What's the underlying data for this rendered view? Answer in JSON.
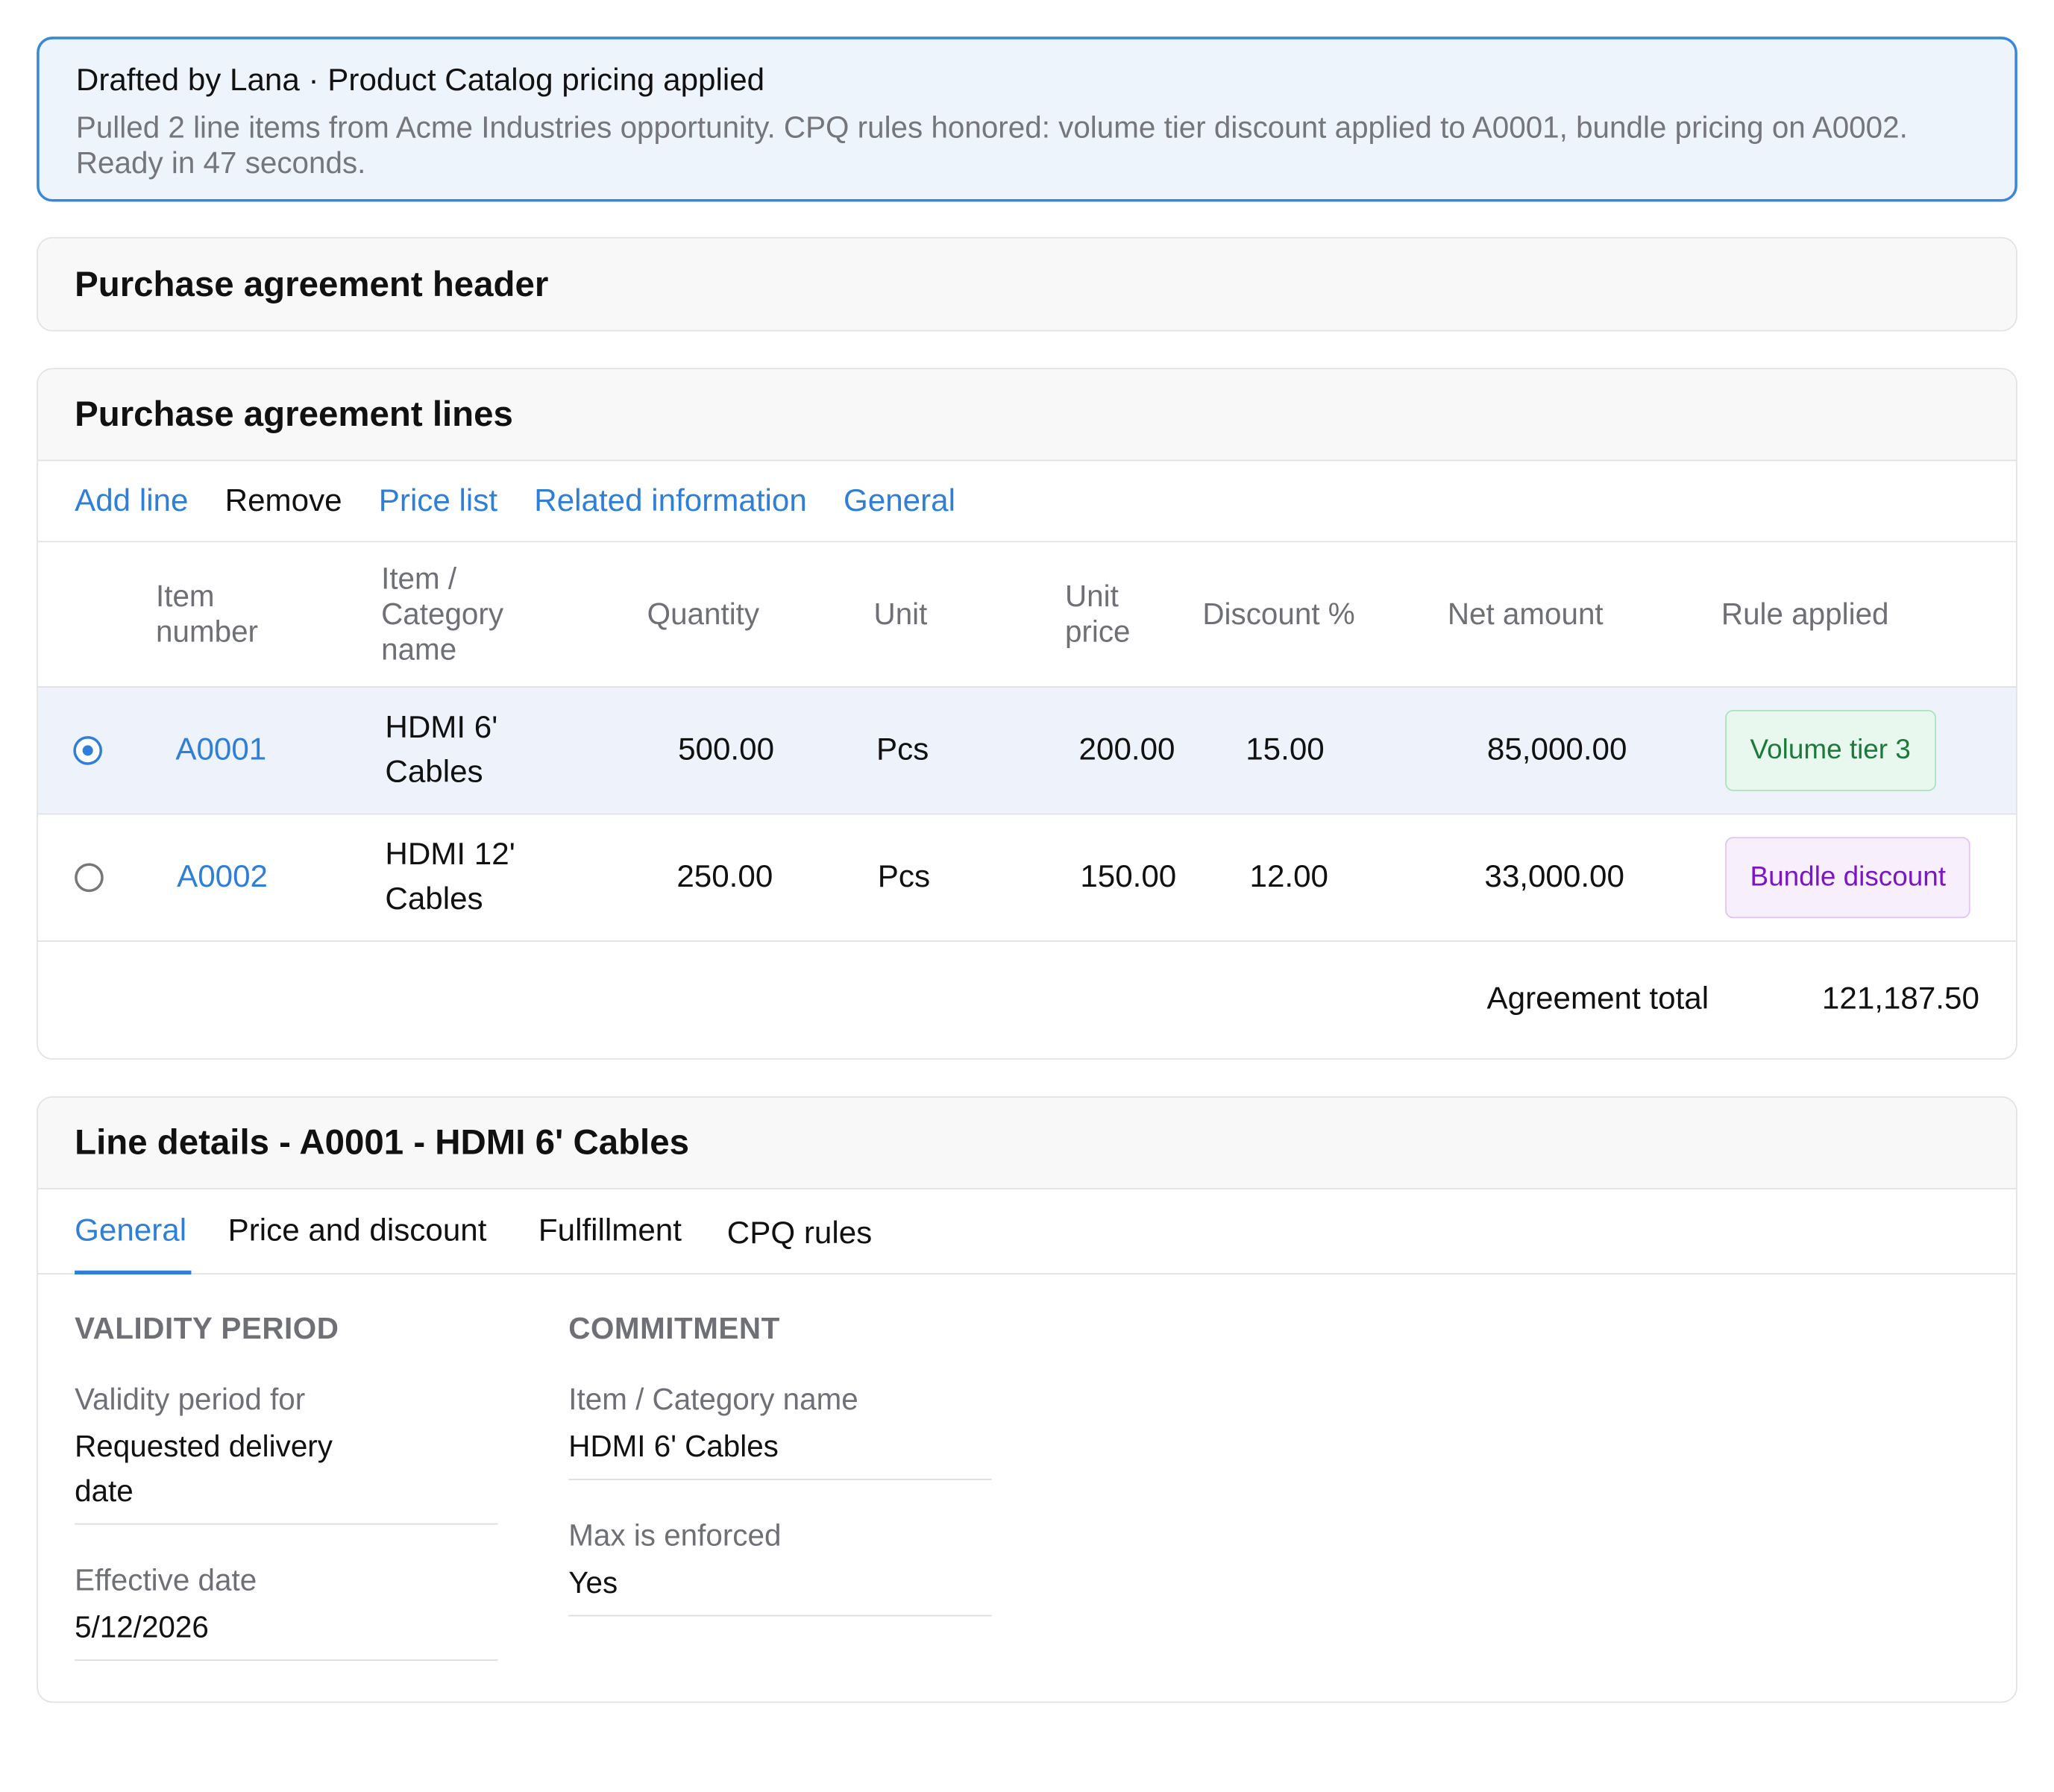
{
  "banner": {
    "title": "Drafted by Lana · Product Catalog pricing applied",
    "text": "Pulled 2 line items from Acme Industries opportunity. CPQ rules honored: volume tier discount applied to A0001, bundle pricing on A0002. Ready in 47 seconds."
  },
  "header_section": {
    "title": "Purchase agreement header"
  },
  "lines_section": {
    "title": "Purchase agreement lines",
    "toolbar": {
      "add_line": "Add line",
      "remove": "Remove",
      "price_list": "Price list",
      "related_information": "Related information",
      "general": "General"
    },
    "columns": {
      "item_number": "Item number",
      "item_category_name": "Item / Category name",
      "quantity": "Quantity",
      "unit": "Unit",
      "unit_price": "Unit price",
      "discount": "Discount %",
      "net_amount": "Net amount",
      "rule_applied": "Rule applied"
    },
    "rows": [
      {
        "selected": true,
        "item_number": "A0001",
        "name": "HDMI 6' Cables",
        "quantity": "500.00",
        "unit": "Pcs",
        "unit_price": "200.00",
        "discount": "15.00",
        "net_amount": "85,000.00",
        "rule": "Volume tier 3",
        "rule_color": "#1b7a3a"
      },
      {
        "selected": false,
        "item_number": "A0002",
        "name": "HDMI 12' Cables",
        "quantity": "250.00",
        "unit": "Pcs",
        "unit_price": "150.00",
        "discount": "12.00",
        "net_amount": "33,000.00",
        "rule": "Bundle discount",
        "rule_color": "#7c16c4"
      }
    ],
    "total_label": "Agreement total",
    "total_value": "121,187.50"
  },
  "details_section": {
    "title": "Line details - A0001 - HDMI 6' Cables",
    "tabs": [
      "General",
      "Price and discount",
      "Fulfillment",
      "CPQ rules"
    ],
    "active_tab": "General",
    "validity": {
      "group_title": "VALIDITY PERIOD",
      "validity_for_label": "Validity period for",
      "validity_for_value": "Requested delivery date",
      "effective_date_label": "Effective date",
      "effective_date_value": "5/12/2026"
    },
    "commitment": {
      "group_title": "COMMITMENT",
      "item_name_label": "Item / Category name",
      "item_name_value": "HDMI 6' Cables",
      "max_enforced_label": "Max is enforced",
      "max_enforced_value": "Yes"
    }
  },
  "colors": {
    "accent": "#2f7fd8",
    "banner_bg": "#eef4fc",
    "selected_row_bg": "#eef3fb"
  }
}
